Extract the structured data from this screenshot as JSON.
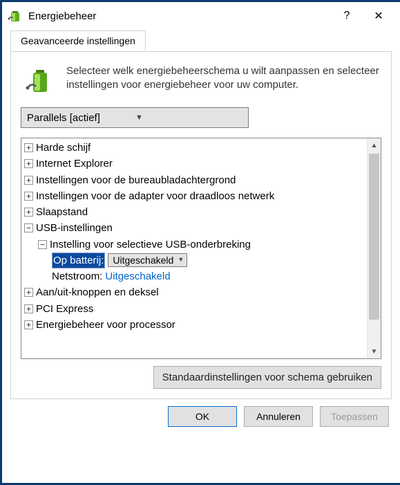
{
  "window": {
    "title": "Energiebeheer",
    "help": "?",
    "close": "✕"
  },
  "tab_label": "Geavanceerde instellingen",
  "intro_text": "Selecteer welk energiebeheerschema u wilt aanpassen en selecteer instellingen voor energiebeheer voor uw computer.",
  "plan_selected": "Parallels [actief]",
  "tree": {
    "n0": "Harde schijf",
    "n1": "Internet Explorer",
    "n2": "Instellingen voor de bureaubladachtergrond",
    "n3": "Instellingen voor de adapter voor draadloos netwerk",
    "n4": "Slaapstand",
    "n5": "USB-instellingen",
    "n5_0": "Instelling voor selectieve USB-onderbreking",
    "n5_0_batt_label": "Op batterij:",
    "n5_0_batt_val": "Uitgeschakeld",
    "n5_0_ac_label": "Netstroom:",
    "n5_0_ac_val": "Uitgeschakeld",
    "n6": "Aan/uit-knoppen en deksel",
    "n7": "PCI Express",
    "n8": "Energiebeheer voor processor"
  },
  "restore_defaults": "Standaardinstellingen voor schema gebruiken",
  "buttons": {
    "ok": "OK",
    "cancel": "Annuleren",
    "apply": "Toepassen"
  }
}
